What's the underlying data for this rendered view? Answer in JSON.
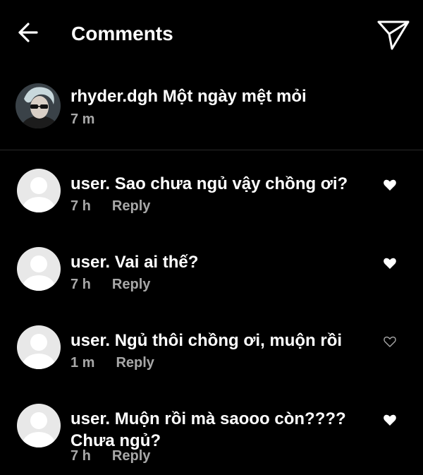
{
  "header": {
    "title": "Comments",
    "back_icon": "arrow-left-icon",
    "send_icon": "paper-plane-icon"
  },
  "caption": {
    "text": "rhyder.dgh Một ngày mệt mỏi",
    "time": "7 m"
  },
  "comments": [
    {
      "text": "user. Sao chưa ngủ vậy chồng ơi?",
      "time": "7 h",
      "reply_label": "Reply",
      "liked": true
    },
    {
      "text": "user. Vai ai thế?",
      "time": "7 h",
      "reply_label": "Reply",
      "liked": true
    },
    {
      "text": "user. Ngủ thôi chồng ơi, muộn rồi",
      "time": "1 m",
      "reply_label": "Reply",
      "liked": false
    },
    {
      "text": "user. Muộn rồi mà saooo còn???? Chưa ngủ?",
      "time": "7 h",
      "reply_label": "Reply",
      "liked": true
    }
  ],
  "colors": {
    "background": "#000000",
    "text": "#ffffff",
    "secondary_text": "#a8a8a8",
    "divider": "#2a2a2a"
  }
}
